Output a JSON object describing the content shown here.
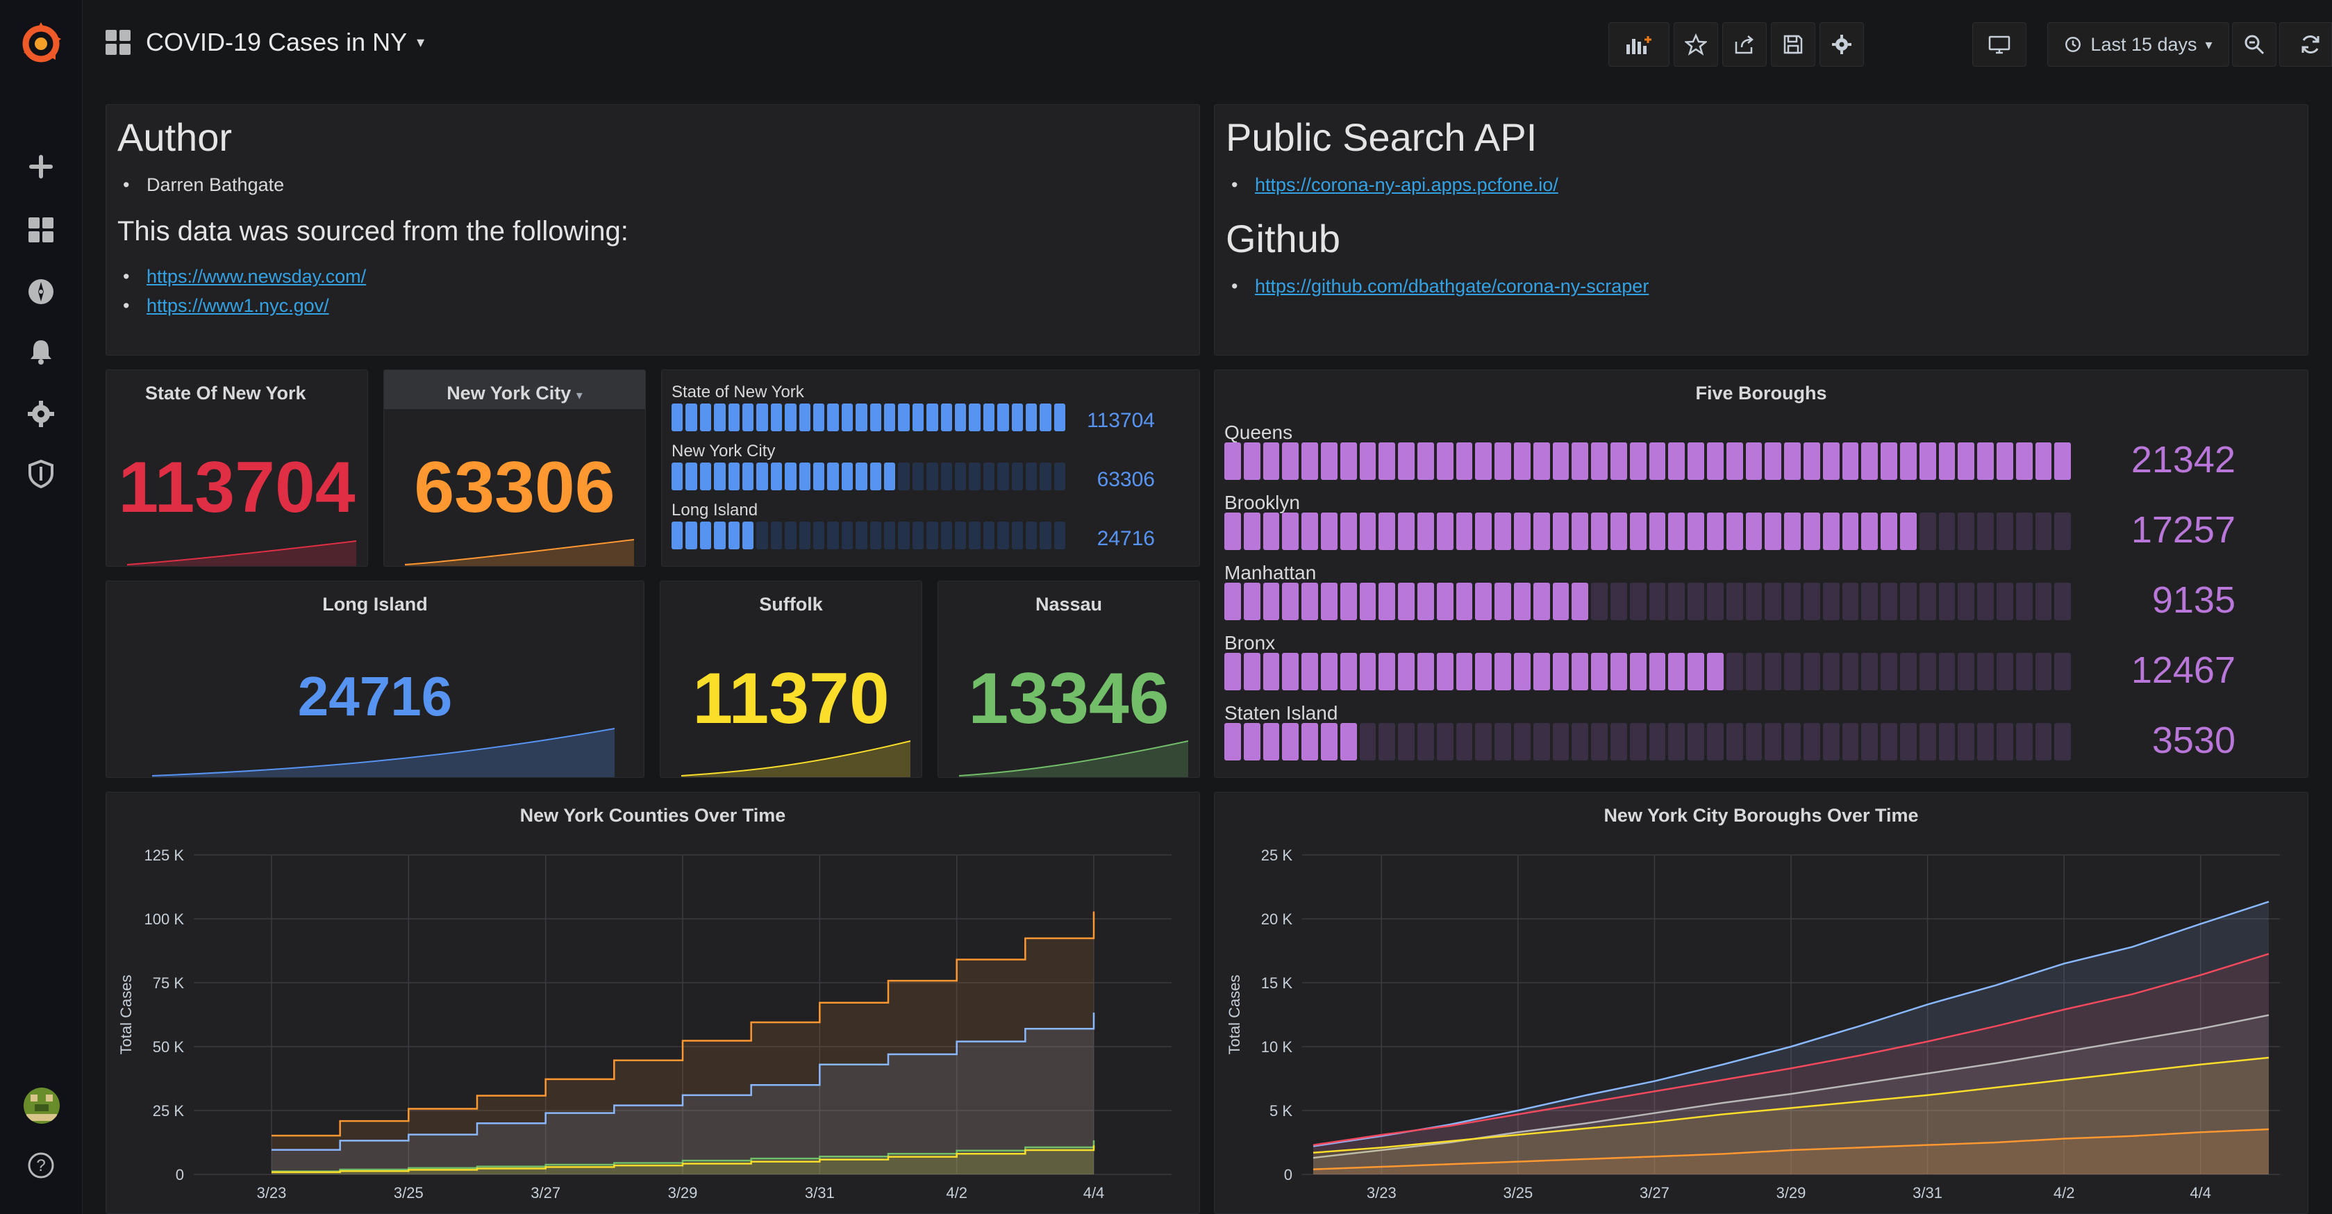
{
  "dashboard": {
    "title": "COVID-19 Cases in NY",
    "time_range": "Last 15 days",
    "refresh_interval": "1m"
  },
  "colors": {
    "red": "#e02f44",
    "orange": "#ff9830",
    "yellow": "#fade2a",
    "green": "#73bf69",
    "blue": "#5794f2",
    "purple": "#b877d9",
    "accent": "#eb7b18",
    "link": "#33a2e5"
  },
  "author_panel": {
    "heading": "Author",
    "author": "Darren Bathgate",
    "sources_heading": "This data was sourced from the following:",
    "sources": [
      "https://www.newsday.com/",
      "https://www1.nyc.gov/"
    ]
  },
  "api_panel": {
    "heading": "Public Search API",
    "api_link": "https://corona-ny-api.apps.pcfone.io/",
    "github_heading": "Github",
    "github_link": "https://github.com/dbathgate/corona-ny-scraper"
  },
  "stats": {
    "state": {
      "title": "State Of New York",
      "value": "113704"
    },
    "nyc": {
      "title": "New York City",
      "value": "63306"
    },
    "long_island": {
      "title": "Long Island",
      "value": "24716"
    },
    "suffolk": {
      "title": "Suffolk",
      "value": "11370"
    },
    "nassau": {
      "title": "Nassau",
      "value": "13346"
    }
  },
  "regions_gauge": {
    "max": 113704,
    "rows": [
      {
        "label": "State of New York",
        "value": 113704
      },
      {
        "label": "New York City",
        "value": 63306
      },
      {
        "label": "Long Island",
        "value": 24716
      }
    ]
  },
  "boroughs_gauge": {
    "title": "Five Boroughs",
    "max": 21342,
    "rows": [
      {
        "label": "Queens",
        "value": 21342
      },
      {
        "label": "Brooklyn",
        "value": 17257
      },
      {
        "label": "Manhattan",
        "value": 9135
      },
      {
        "label": "Bronx",
        "value": 12467
      },
      {
        "label": "Staten Island",
        "value": 3530
      }
    ]
  },
  "chart_data": [
    {
      "type": "area",
      "title": "New York Counties Over Time",
      "ylabel": "Total Cases",
      "xlabel": "",
      "x_ticks": [
        "3/23",
        "3/25",
        "3/27",
        "3/29",
        "3/31",
        "4/2",
        "4/4"
      ],
      "y_ticks": [
        "0",
        "25 K",
        "50 K",
        "75 K",
        "100 K",
        "125 K"
      ],
      "ylim": [
        0,
        125000
      ],
      "x": [
        "3/23",
        "3/24",
        "3/25",
        "3/26",
        "3/27",
        "3/28",
        "3/29",
        "3/30",
        "3/31",
        "4/1",
        "4/2",
        "4/3",
        "4/4"
      ],
      "series": [
        {
          "color": "#ff9830",
          "values": [
            15168,
            20875,
            25665,
            30811,
            37258,
            44635,
            52318,
            59513,
            67174,
            75795,
            84085,
            92381,
            102863
          ]
        },
        {
          "color": "#8ab8ff",
          "values": [
            9600,
            13200,
            15600,
            20000,
            24000,
            27000,
            31000,
            35000,
            43000,
            47000,
            52000,
            57000,
            63306
          ]
        },
        {
          "color": "#73bf69",
          "values": [
            1200,
            1900,
            2500,
            3100,
            3800,
            4500,
            5400,
            6200,
            7000,
            8100,
            9300,
            10600,
            13346
          ]
        },
        {
          "color": "#fade2a",
          "values": [
            900,
            1300,
            1800,
            2300,
            2900,
            3500,
            4200,
            5000,
            5800,
            6900,
            8100,
            9500,
            11370
          ]
        }
      ]
    },
    {
      "type": "area",
      "title": "New York City Boroughs Over Time",
      "ylabel": "Total Cases",
      "xlabel": "",
      "x_ticks": [
        "3/23",
        "3/25",
        "3/27",
        "3/29",
        "3/31",
        "4/2",
        "4/4"
      ],
      "y_ticks": [
        "0",
        "5 K",
        "10 K",
        "15 K",
        "20 K",
        "25 K"
      ],
      "ylim": [
        0,
        25000
      ],
      "x": [
        "3/22",
        "3/23",
        "3/24",
        "3/25",
        "3/26",
        "3/27",
        "3/28",
        "3/29",
        "3/30",
        "3/31",
        "4/1",
        "4/2",
        "4/3",
        "4/4",
        "4/5"
      ],
      "series": [
        {
          "color": "#8ab8ff",
          "values": [
            2200,
            3000,
            3900,
            5000,
            6200,
            7300,
            8600,
            10000,
            11600,
            13300,
            14800,
            16500,
            17800,
            19600,
            21342
          ]
        },
        {
          "color": "#f2495c",
          "values": [
            2300,
            3100,
            3800,
            4700,
            5600,
            6500,
            7400,
            8300,
            9300,
            10400,
            11600,
            12900,
            14100,
            15600,
            17257
          ]
        },
        {
          "color": "#b8b8b8",
          "values": [
            1300,
            1900,
            2500,
            3300,
            4000,
            4800,
            5600,
            6300,
            7100,
            7900,
            8700,
            9600,
            10500,
            11400,
            12467
          ]
        },
        {
          "color": "#fade2a",
          "values": [
            1700,
            2100,
            2600,
            3100,
            3600,
            4100,
            4700,
            5200,
            5700,
            6200,
            6800,
            7400,
            8000,
            8600,
            9135
          ]
        },
        {
          "color": "#ff9830",
          "values": [
            400,
            600,
            800,
            1000,
            1200,
            1400,
            1600,
            1900,
            2100,
            2300,
            2500,
            2800,
            3000,
            3300,
            3530
          ]
        }
      ]
    }
  ]
}
